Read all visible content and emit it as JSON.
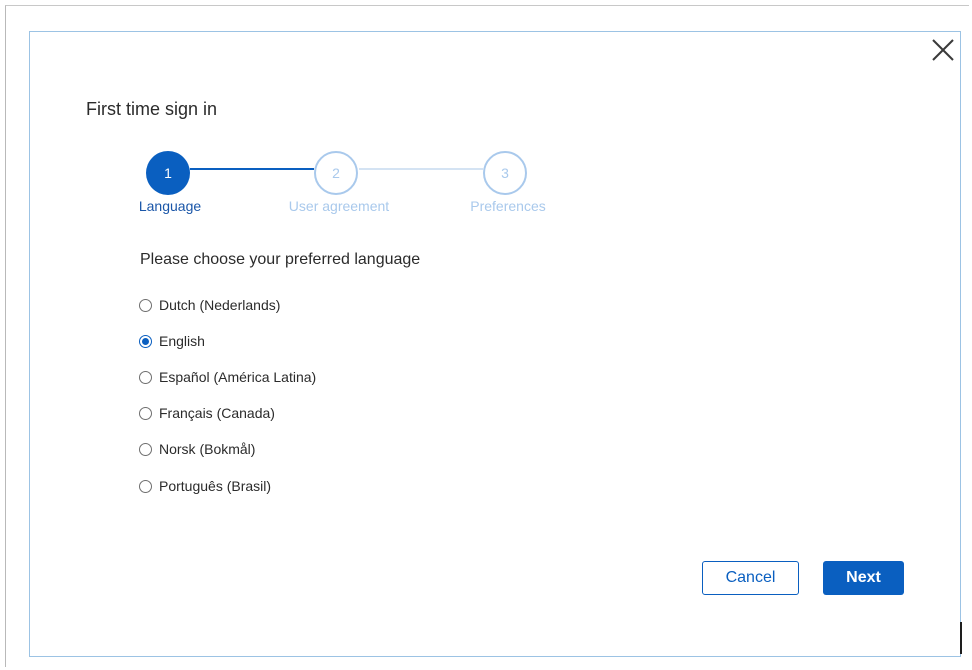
{
  "dialog": {
    "title": "First time sign in",
    "close_icon": "close-icon"
  },
  "stepper": {
    "steps": [
      {
        "number": "1",
        "label": "Language",
        "state": "active"
      },
      {
        "number": "2",
        "label": "User agreement",
        "state": "inactive"
      },
      {
        "number": "3",
        "label": "Preferences",
        "state": "inactive"
      }
    ]
  },
  "language": {
    "question": "Please choose your preferred language",
    "selected": "English",
    "options": [
      {
        "label": "Dutch (Nederlands)",
        "checked": false
      },
      {
        "label": "English",
        "checked": true
      },
      {
        "label": "Español (América Latina)",
        "checked": false
      },
      {
        "label": "Français (Canada)",
        "checked": false
      },
      {
        "label": "Norsk (Bokmål)",
        "checked": false
      },
      {
        "label": "Português (Brasil)",
        "checked": false
      }
    ]
  },
  "actions": {
    "cancel_label": "Cancel",
    "next_label": "Next"
  },
  "colors": {
    "primary": "#0a5fc0",
    "inactive_step": "#a9c9ec",
    "dialog_border": "#9cc3e4"
  }
}
